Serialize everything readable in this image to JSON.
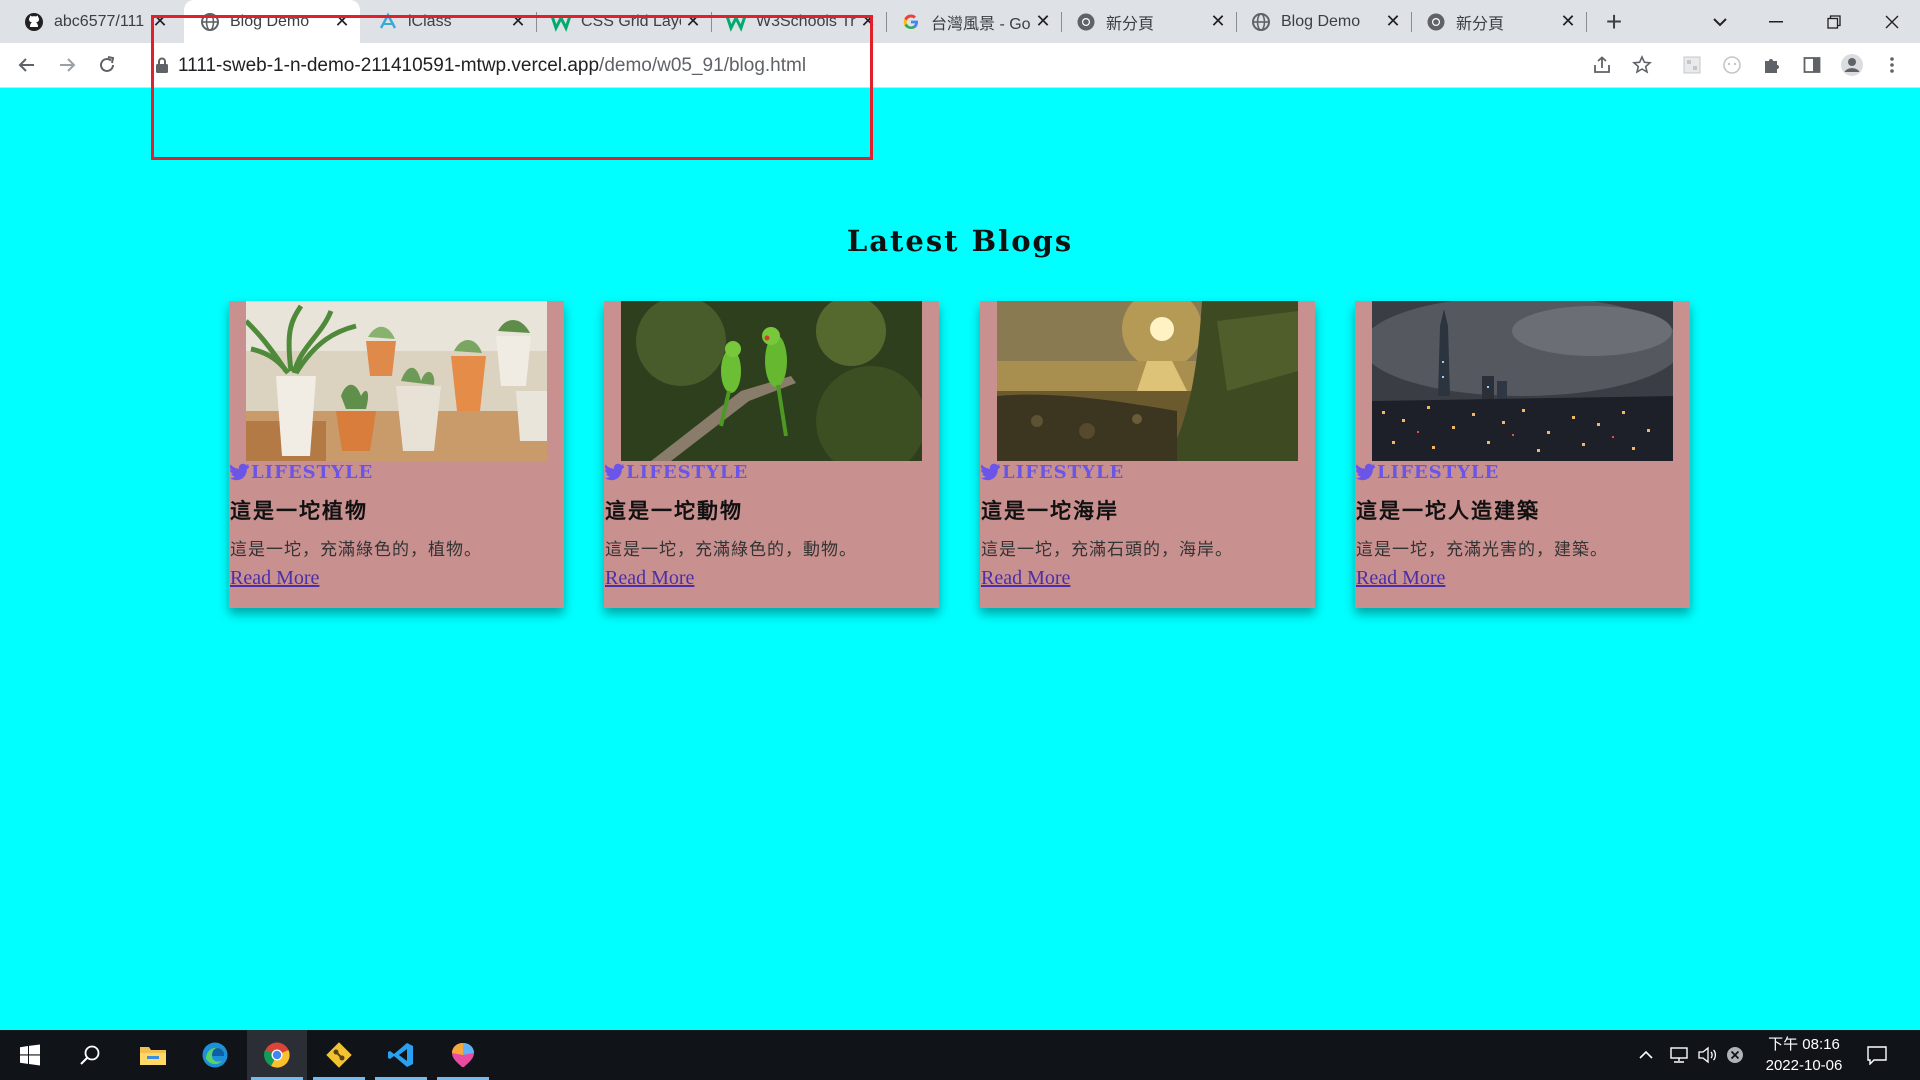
{
  "browser": {
    "tabs": [
      {
        "title": "abc6577/111",
        "icon": "github-icon",
        "active": false
      },
      {
        "title": "Blog Demo",
        "icon": "globe-icon",
        "active": true
      },
      {
        "title": "iClass",
        "icon": "iclass-icon",
        "active": false
      },
      {
        "title": "CSS Grid Layo",
        "icon": "w3schools-icon",
        "active": false
      },
      {
        "title": "W3Schools Tr",
        "icon": "w3schools-icon",
        "active": false
      },
      {
        "title": "台灣風景 - Go",
        "icon": "google-icon",
        "active": false
      },
      {
        "title": "新分頁",
        "icon": "chrome-icon",
        "active": false
      },
      {
        "title": "Blog Demo",
        "icon": "globe-icon",
        "active": false
      },
      {
        "title": "新分頁",
        "icon": "chrome-icon",
        "active": false
      }
    ],
    "url_domain": "1111-sweb-1-n-demo-211410591-mtwp.vercel.app",
    "url_path": "/demo/w05_91/blog.html"
  },
  "page": {
    "title": "Latest Blogs",
    "cards": [
      {
        "category": "LIFESTYLE",
        "title": "這是一坨植物",
        "description": "這是一坨，充滿綠色的，植物。",
        "link": "Read More",
        "image": "potted-plants-photo"
      },
      {
        "category": "LIFESTYLE",
        "title": "這是一坨動物",
        "description": "這是一坨，充滿綠色的，動物。",
        "link": "Read More",
        "image": "green-parrots-photo"
      },
      {
        "category": "LIFESTYLE",
        "title": "這是一坨海岸",
        "description": "這是一坨，充滿石頭的，海岸。",
        "link": "Read More",
        "image": "coast-sunset-photo"
      },
      {
        "category": "LIFESTYLE",
        "title": "這是一坨人造建築",
        "description": "這是一坨，充滿光害的，建築。",
        "link": "Read More",
        "image": "city-night-photo"
      }
    ]
  },
  "taskbar": {
    "clock_time": "下午 08:16",
    "clock_date": "2022-10-06",
    "apps": [
      "start-icon",
      "search-icon",
      "file-explorer-icon",
      "edge-icon",
      "chrome-icon",
      "git-icon",
      "vscode-icon",
      "paint-icon"
    ]
  },
  "colors": {
    "page_background": "#00ffff",
    "card_background": "#c99090",
    "category_color": "#6a55e8",
    "annotation_border": "#e0202b"
  }
}
